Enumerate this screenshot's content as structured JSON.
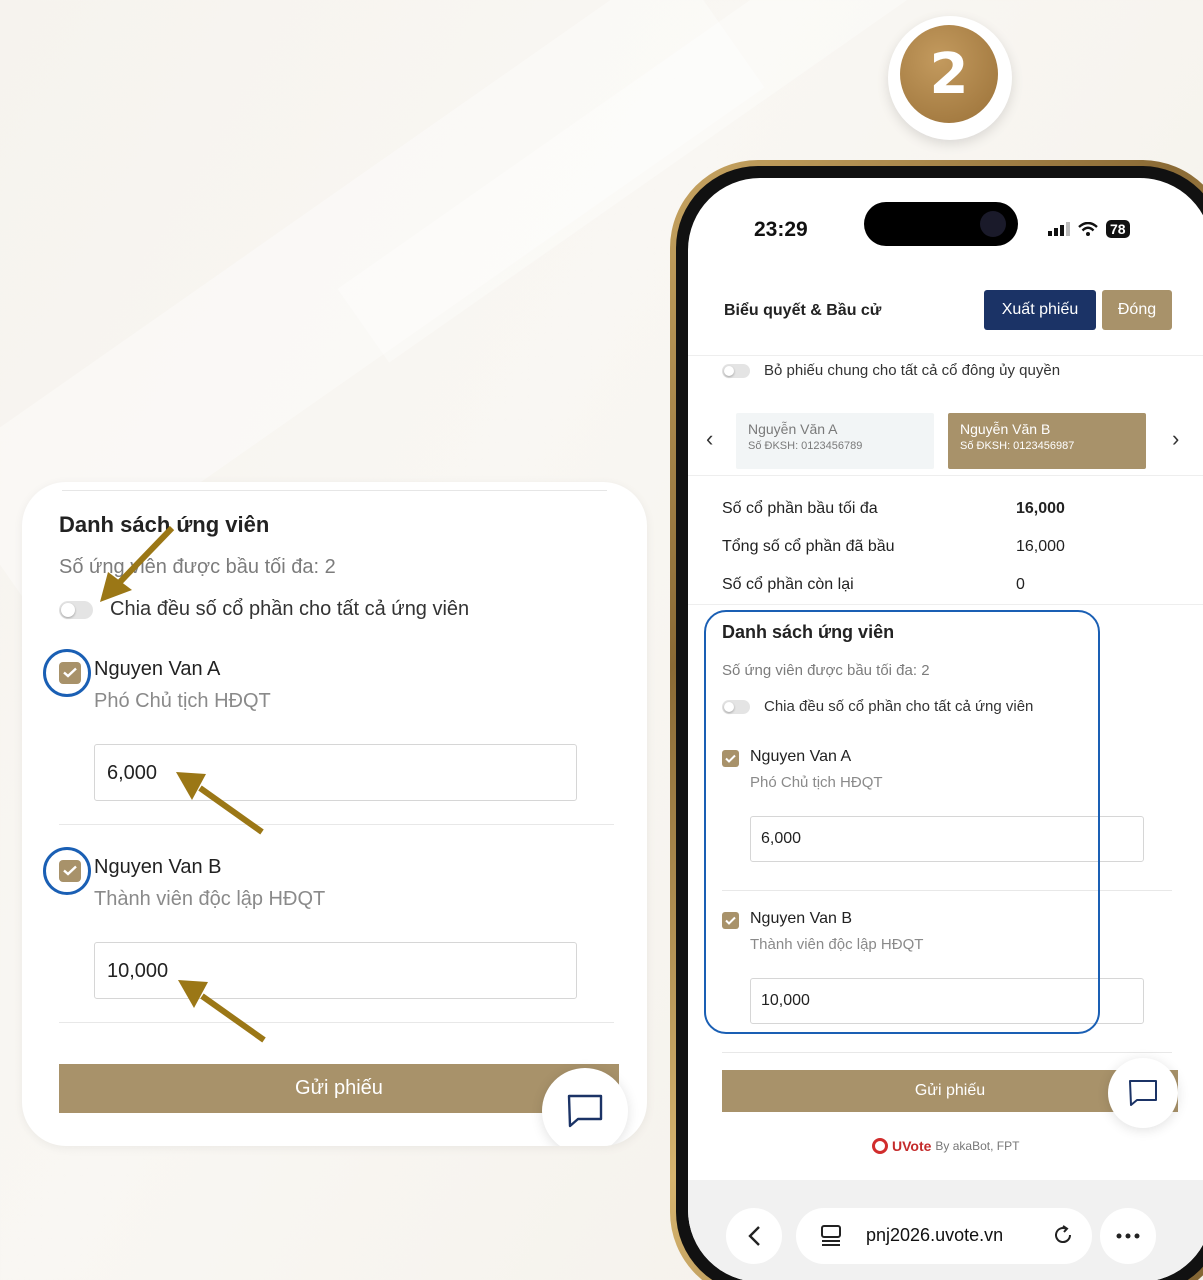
{
  "step_badge": "2",
  "zoom": {
    "title": "Danh sách ứng viên",
    "subtitle": "Số ứng viên được bầu tối đa: 2",
    "toggle_label": "Chia đều số cổ phần cho tất cả ứng viên",
    "candidates": [
      {
        "name": "Nguyen Van A",
        "role": "Phó Chủ tịch HĐQT",
        "shares": "6,000"
      },
      {
        "name": "Nguyen Van B",
        "role": "Thành viên độc lập HĐQT",
        "shares": "10,000"
      }
    ],
    "submit_label": "Gửi phiếu"
  },
  "phone": {
    "status": {
      "time": "23:29",
      "battery": "78"
    },
    "header": {
      "title": "Biểu quyết & Bầu cử",
      "export_label": "Xuất phiếu",
      "close_label": "Đóng"
    },
    "proxy_toggle_label": "Bỏ phiếu chung cho tất cả cổ đông ủy quyền",
    "shareholders": [
      {
        "name": "Nguyễn Văn A",
        "id": "Số ĐKSH: 0123456789",
        "selected": false
      },
      {
        "name": "Nguyễn Văn B",
        "id": "Số ĐKSH: 0123456987",
        "selected": true
      }
    ],
    "stats": [
      {
        "label": "Số cổ phần bầu tối đa",
        "value": "16,000"
      },
      {
        "label": "Tổng số cổ phần đã bầu",
        "value": "16,000"
      },
      {
        "label": "Số cổ phần còn lại",
        "value": "0"
      }
    ],
    "list": {
      "title": "Danh sách ứng viên",
      "subtitle": "Số ứng viên được bầu tối đa: 2",
      "toggle_label": "Chia đều số cổ phần cho tất cả ứng viên",
      "candidates": [
        {
          "name": "Nguyen Van A",
          "role": "Phó Chủ tịch HĐQT",
          "shares": "6,000"
        },
        {
          "name": "Nguyen Van B",
          "role": "Thành viên độc lập HĐQT",
          "shares": "10,000"
        }
      ]
    },
    "submit_label": "Gửi phiếu",
    "brand": {
      "name": "UVote",
      "byline": "By akaBot, FPT"
    },
    "browser": {
      "url": "pnj2026.uvote.vn"
    }
  },
  "colors": {
    "gold": "#a8926a",
    "navy": "#1b3366",
    "highlight_blue": "#1a5fb4",
    "arrow": "#9b7716"
  }
}
